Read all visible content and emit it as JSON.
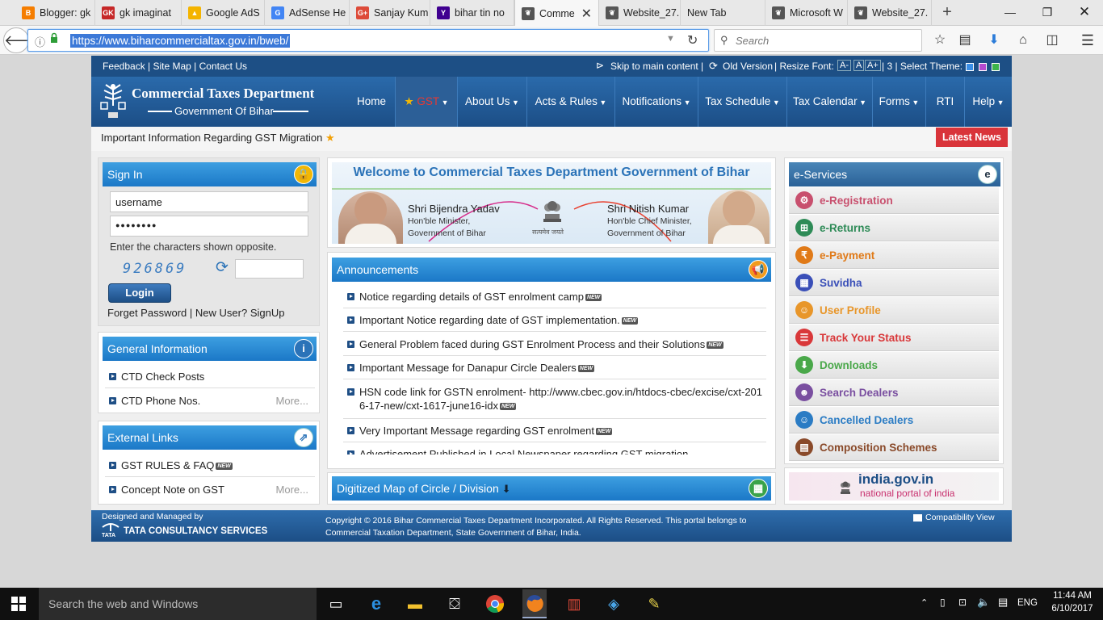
{
  "browser": {
    "tabs": [
      {
        "label": "Blogger: gk",
        "icon": "blogger-icon",
        "color": "#f57d00",
        "glyph": "B"
      },
      {
        "label": "gk imaginat",
        "icon": "gk-icon",
        "color": "#c62828",
        "glyph": "GK"
      },
      {
        "label": "Google AdS",
        "icon": "adsense-icon",
        "color": "#f4b400",
        "glyph": "▲"
      },
      {
        "label": "AdSense He",
        "icon": "google-icon",
        "color": "#4285f4",
        "glyph": "G"
      },
      {
        "label": "Sanjay Kum",
        "icon": "google-plus-icon",
        "color": "#dd4b39",
        "glyph": "G+"
      },
      {
        "label": "bihar tin no",
        "icon": "yahoo-icon",
        "color": "#400090",
        "glyph": "Y"
      },
      {
        "label": "Comme",
        "icon": "bihar-emblem-icon",
        "color": "#555555",
        "glyph": "❦"
      },
      {
        "label": "Website_27.",
        "icon": "bihar-emblem-icon",
        "color": "#555555",
        "glyph": "❦"
      },
      {
        "label": "New Tab",
        "icon": "",
        "color": "",
        "glyph": ""
      },
      {
        "label": "Microsoft W",
        "icon": "bihar-emblem-icon",
        "color": "#555555",
        "glyph": "❦"
      },
      {
        "label": "Website_27.",
        "icon": "bihar-emblem-icon",
        "color": "#555555",
        "glyph": "❦"
      }
    ],
    "url": "https://www.biharcommercialtax.gov.in/bweb/",
    "search_placeholder": "Search"
  },
  "site": {
    "topstrip": {
      "left": "Feedback | Site Map | Contact Us",
      "skip": "Skip to main content |",
      "old_version": "Old Version",
      "resize": "| Resize Font:",
      "font_small": "A-",
      "font_normal": "A",
      "font_large": "A+",
      "theme": "| 3 | Select Theme:",
      "theme_colors": [
        "#3a8ee6",
        "#b64bcf",
        "#3db34a"
      ]
    },
    "header": {
      "title": "Commercial Taxes Department",
      "subtitle": "Government Of Bihar",
      "menu": [
        "Home",
        "GST",
        "About Us",
        "Acts & Rules",
        "Notifications",
        "Tax Schedule",
        "Tax Calendar",
        "Forms",
        "RTI",
        "Help"
      ]
    },
    "ticker": {
      "text": "Important Information Regarding GST Migration",
      "latest_news": "Latest News"
    },
    "signin": {
      "title": "Sign In",
      "username": "username",
      "password": "●●●●●●●●",
      "captcha_prompt": "Enter the characters shown opposite.",
      "captcha": "926869",
      "login": "Login",
      "forget": "Forget Password",
      "separator": "|",
      "signup": "New User? SignUp"
    },
    "general_info": {
      "title": "General Information",
      "items": [
        "CTD Check Posts",
        "CTD Phone Nos."
      ],
      "more": "More..."
    },
    "external_links": {
      "title": "External Links",
      "items": [
        "GST RULES & FAQ",
        "Concept Note on GST"
      ],
      "more": "More...",
      "new_tag": "NEW"
    },
    "welcome": {
      "title": "Welcome to Commercial Taxes Department Government of Bihar",
      "left_name": "Shri Bijendra Yadav",
      "left_role1": "Hon'ble Minister,",
      "left_role2": "Government of Bihar",
      "right_name": "Shri Nitish Kumar",
      "right_role1": "Hon'ble Chief Minister,",
      "right_role2": "Government of Bihar",
      "motto": "सत्यमेव जयते"
    },
    "announcements": {
      "title": "Announcements",
      "new_tag": "NEW",
      "items": [
        "Notice regarding details of GST enrolment camp",
        "Important Notice regarding date of GST implementation.",
        "General Problem faced during GST Enrolment Process and their Solutions",
        "Important Message for Danapur Circle Dealers",
        "HSN code link for GSTN enrolment- http://www.cbec.gov.in/htdocs-cbec/excise/cxt-2016-17-new/cxt-1617-june16-idx",
        "Very Important Message regarding GST enrolment",
        "Advertisement Published in Local Newspaper regarding GST migration"
      ]
    },
    "map": {
      "title": "Digitized Map of Circle / Division"
    },
    "eservices": {
      "title": "e-Services",
      "items": [
        {
          "label": "e-Registration",
          "color": "#c8506e",
          "icon": "registration-icon",
          "glyph": "⚙"
        },
        {
          "label": "e-Returns",
          "color": "#2e8b57",
          "icon": "returns-icon",
          "glyph": "⊞"
        },
        {
          "label": "e-Payment",
          "color": "#e07a18",
          "icon": "payment-icon",
          "glyph": "₹"
        },
        {
          "label": "Suvidha",
          "color": "#3a4fb8",
          "icon": "suvidha-icon",
          "glyph": "▦"
        },
        {
          "label": "User Profile",
          "color": "#e8962a",
          "icon": "user-profile-icon",
          "glyph": "☺"
        },
        {
          "label": "Track Your Status",
          "color": "#d9383a",
          "icon": "track-status-icon",
          "glyph": "☰"
        },
        {
          "label": "Downloads",
          "color": "#4aa84a",
          "icon": "downloads-icon",
          "glyph": "⬇"
        },
        {
          "label": "Search Dealers",
          "color": "#7a4fa0",
          "icon": "search-dealers-icon",
          "glyph": "☻"
        },
        {
          "label": "Cancelled Dealers",
          "color": "#2b7cc4",
          "icon": "cancelled-dealers-icon",
          "glyph": "☺"
        },
        {
          "label": "Composition Schemes",
          "color": "#8a4a2a",
          "icon": "composition-icon",
          "glyph": "▤"
        }
      ]
    },
    "indiagov": {
      "title": "india.gov.in",
      "subtitle": "national portal of india"
    },
    "footer": {
      "designed": "Designed and Managed by",
      "tcs": "TATA CONSULTANCY SERVICES",
      "tata": "TATA",
      "copyright1": "Copyright © 2016 Bihar Commercial Taxes Department Incorporated. All Rights Reserved. This portal belongs to",
      "copyright2": "Commercial Taxation Department, State Government of Bihar, India.",
      "compat": "Compatibility View"
    }
  },
  "taskbar": {
    "search": "Search the web and Windows",
    "lang": "ENG",
    "time": "11:44 AM",
    "date": "6/10/2017"
  }
}
